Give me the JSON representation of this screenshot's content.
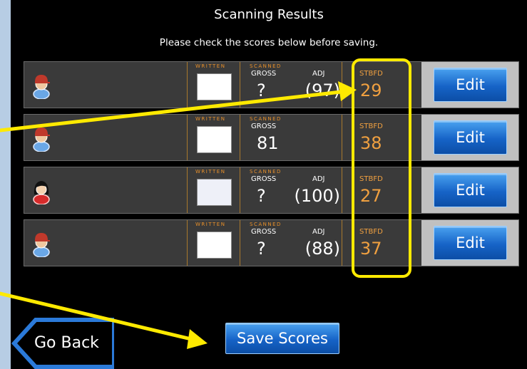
{
  "header": {
    "title": "Scanning Results",
    "subtitle": "Please check the scores below before saving."
  },
  "column_labels": {
    "written": "WRITTEN",
    "scanned": "SCANNED",
    "gross": "GROSS",
    "adj": "ADJ",
    "stbfd": "STBFD"
  },
  "players": [
    {
      "avatar": "male-player-icon",
      "gross": "?",
      "adj": "(97)",
      "stbfd": "29",
      "edit_label": "Edit"
    },
    {
      "avatar": "male-player-icon",
      "gross": "81",
      "adj": "",
      "stbfd": "38",
      "edit_label": "Edit"
    },
    {
      "avatar": "female-player-icon",
      "gross": "?",
      "adj": "(100)",
      "stbfd": "27",
      "edit_label": "Edit"
    },
    {
      "avatar": "male-player-icon",
      "gross": "?",
      "adj": "(88)",
      "stbfd": "37",
      "edit_label": "Edit"
    }
  ],
  "footer": {
    "go_back_label": "Go Back",
    "save_label": "Save Scores"
  },
  "colors": {
    "accent_yellow": "#ffea00",
    "button_blue": "#1663c7",
    "stbfd_orange": "#f0a040",
    "label_orange": "#e8902a"
  }
}
